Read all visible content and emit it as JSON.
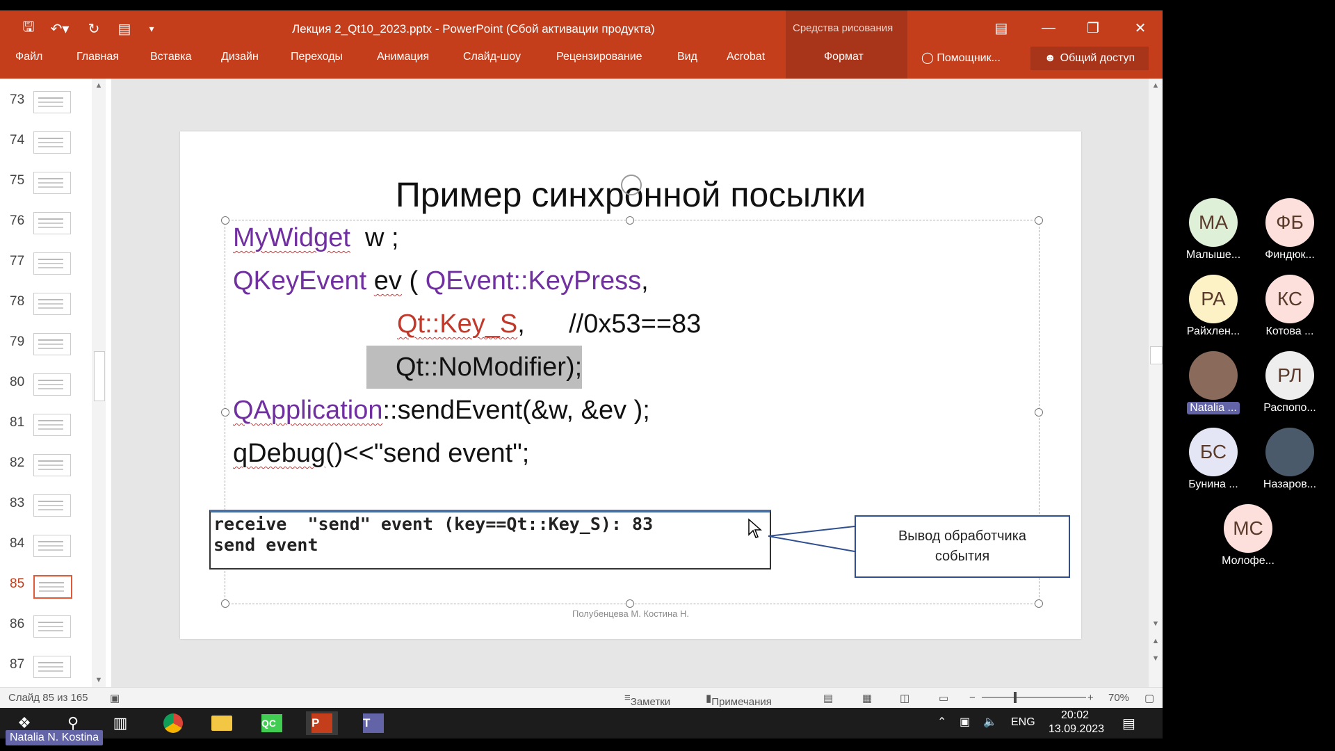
{
  "window": {
    "title": "Лекция 2_Qt10_2023.pptx - PowerPoint (Сбой активации продукта)",
    "context_label": "Средства рисования"
  },
  "ribbon": {
    "tabs": [
      "Файл",
      "Главная",
      "Вставка",
      "Дизайн",
      "Переходы",
      "Анимация",
      "Слайд-шоу",
      "Рецензирование",
      "Вид",
      "Acrobat",
      "Формат"
    ],
    "helper": "Помощник...",
    "share": "Общий доступ"
  },
  "thumbnails": {
    "items": [
      "73",
      "74",
      "75",
      "76",
      "77",
      "78",
      "79",
      "80",
      "81",
      "82",
      "83",
      "84",
      "85",
      "86",
      "87"
    ],
    "active": "85"
  },
  "slide": {
    "title": "Пример синхронной посылки",
    "line1_type": "MyWidget",
    "line1_rest": "  w ;",
    "line2_type": "QKeyEvent",
    "line2_var": "ev",
    "line2_paren": " ( ",
    "line2_event": "QEvent::KeyPress",
    "line2_comma": ",",
    "line3_key": "Qt::Key_S",
    "line3_comment": ",      //0x53==83",
    "line4_mod": "Qt::NoModifier",
    "line4_end": ");",
    "line5_class": "QApplication",
    "line5_rest": "::sendEvent(&w, &ev );",
    "line6_func": "qDebug",
    "line6_rest": "()<<\"send event\";",
    "console_line1": "receive  \"send\" event (key==Qt::Key_S): 83",
    "console_line2": "send event",
    "callout": "Вывод обработчика события",
    "footer": "Полубенцева М. Костина Н."
  },
  "status": {
    "slide_counter": "Слайд 85 из 165",
    "notes": "Заметки",
    "comments": "Примечания",
    "zoom": "70%",
    "zoom_level": 0.7
  },
  "taskbar": {
    "lang": "ENG",
    "time": "20:02",
    "date": "13.09.2023"
  },
  "participants": [
    {
      "initials": "МА",
      "name": "Малыше...",
      "color": "#dff0d8"
    },
    {
      "initials": "ФБ",
      "name": "Финдюк...",
      "color": "#fde0dc"
    },
    {
      "initials": "РА",
      "name": "Райхлен...",
      "color": "#fdf2c6"
    },
    {
      "initials": "КС",
      "name": "Котова ...",
      "color": "#fde0dc"
    },
    {
      "initials": "",
      "name": "Natalia ...",
      "color": "#8a6a5a"
    },
    {
      "initials": "РЛ",
      "name": "Распопо...",
      "color": "#eeeeee"
    },
    {
      "initials": "БС",
      "name": "Бунина ...",
      "color": "#e4e6f5"
    },
    {
      "initials": "",
      "name": "Назаров...",
      "color": "#4a5a6a"
    },
    {
      "initials": "МС",
      "name": "Молофе...",
      "color": "#fde0dc"
    }
  ],
  "presenter_chip": "Natalia N. Kostina"
}
